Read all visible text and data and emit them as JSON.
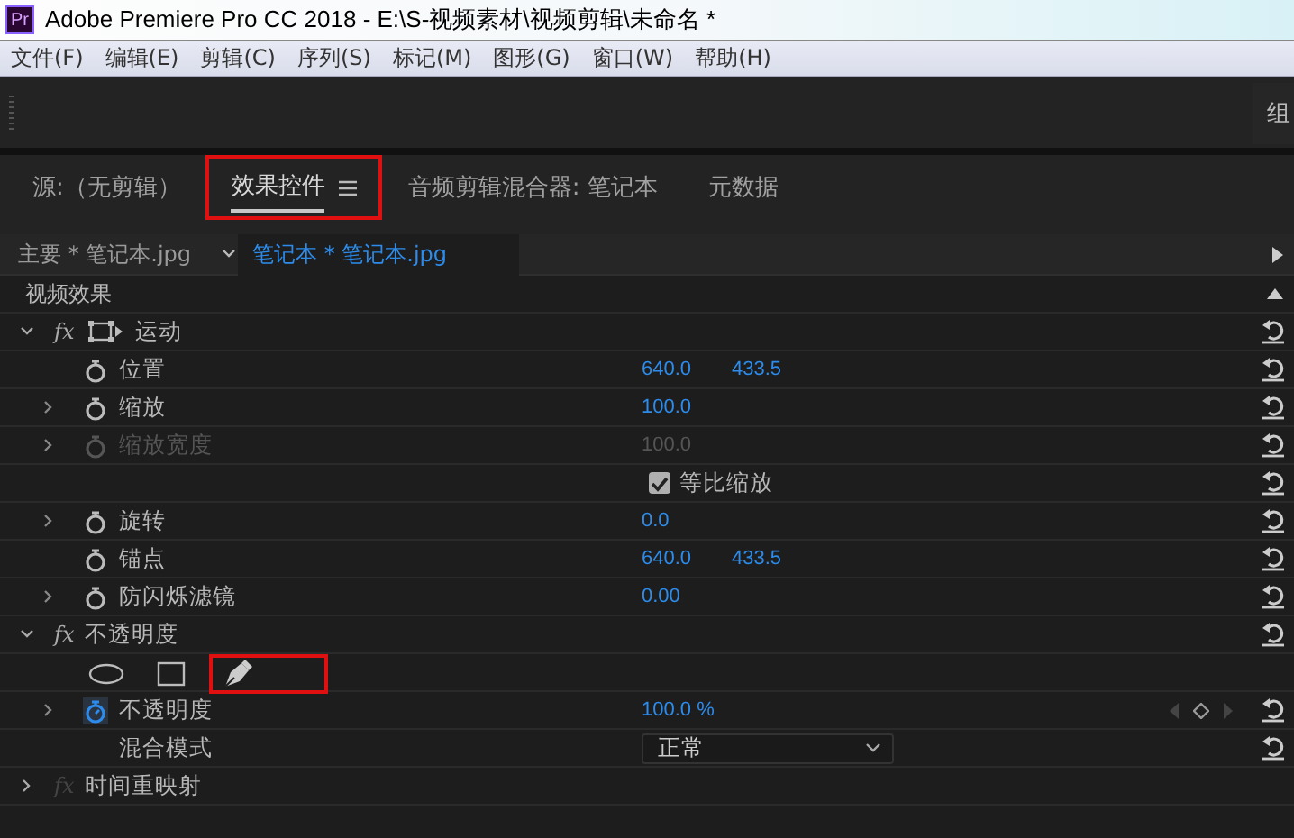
{
  "window": {
    "app_icon": "Pr",
    "title": "Adobe Premiere Pro CC 2018 - E:\\S-视频素材\\视频剪辑\\未命名 *"
  },
  "menu": [
    {
      "label": "文件(F)"
    },
    {
      "label": "编辑(E)"
    },
    {
      "label": "剪辑(C)"
    },
    {
      "label": "序列(S)"
    },
    {
      "label": "标记(M)"
    },
    {
      "label": "图形(G)"
    },
    {
      "label": "窗口(W)"
    },
    {
      "label": "帮助(H)"
    }
  ],
  "toolbar": {
    "workspace_label": "组"
  },
  "tabs": [
    {
      "label": "源:（无剪辑）",
      "selected": false,
      "highlighted": false,
      "menu_icon": false
    },
    {
      "label": "效果控件",
      "selected": true,
      "highlighted": true,
      "menu_icon": true
    },
    {
      "label": "音频剪辑混合器: 笔记本",
      "selected": false,
      "highlighted": false,
      "menu_icon": false
    },
    {
      "label": "元数据",
      "selected": false,
      "highlighted": false,
      "menu_icon": false
    }
  ],
  "clip_tabs": [
    {
      "label": "主要 * 笔记本.jpg",
      "selected": false
    },
    {
      "label": "笔记本 * 笔记本.jpg",
      "selected": true
    }
  ],
  "panel": {
    "section_label": "视频效果",
    "rows": [
      {
        "kind": "effect",
        "badge": "fx",
        "badge_enabled": true,
        "label": "运动",
        "expanded": true,
        "motion_icon": true,
        "resettable": true
      },
      {
        "kind": "property",
        "label": "位置",
        "expandable": false,
        "animated": false,
        "disabled": false,
        "values": [
          "640.0",
          "433.5"
        ],
        "resettable": true
      },
      {
        "kind": "property",
        "label": "缩放",
        "expandable": true,
        "animated": false,
        "disabled": false,
        "values": [
          "100.0"
        ],
        "resettable": true
      },
      {
        "kind": "property",
        "label": "缩放宽度",
        "expandable": true,
        "animated": false,
        "disabled": true,
        "values": [
          "100.0"
        ],
        "resettable": true
      },
      {
        "kind": "checkbox",
        "label": "等比缩放",
        "checked": true,
        "resettable": true
      },
      {
        "kind": "property",
        "label": "旋转",
        "expandable": true,
        "animated": false,
        "disabled": false,
        "values": [
          "0.0"
        ],
        "resettable": true
      },
      {
        "kind": "property",
        "label": "锚点",
        "expandable": false,
        "animated": false,
        "disabled": false,
        "values": [
          "640.0",
          "433.5"
        ],
        "resettable": true
      },
      {
        "kind": "property",
        "label": "防闪烁滤镜",
        "expandable": true,
        "animated": false,
        "disabled": false,
        "values": [
          "0.00"
        ],
        "resettable": true
      },
      {
        "kind": "effect",
        "badge": "fx",
        "badge_enabled": true,
        "label": "不透明度",
        "expanded": true,
        "motion_icon": false,
        "resettable": true
      },
      {
        "kind": "mask_tools",
        "tools": [
          {
            "kind": "ellipse",
            "highlighted": false
          },
          {
            "kind": "rectangle",
            "highlighted": false
          },
          {
            "kind": "pen",
            "highlighted": true
          }
        ],
        "resettable": false
      },
      {
        "kind": "property",
        "label": "不透明度",
        "expandable": true,
        "animated": true,
        "disabled": false,
        "values": [
          "100.0 %"
        ],
        "keyframe_nav": true,
        "resettable": true
      },
      {
        "kind": "dropdown",
        "label": "混合模式",
        "value": "正常",
        "resettable": true
      },
      {
        "kind": "effect",
        "badge": "fx",
        "badge_enabled": false,
        "label": "时间重映射",
        "expanded": false,
        "motion_icon": false,
        "resettable": false
      }
    ]
  }
}
